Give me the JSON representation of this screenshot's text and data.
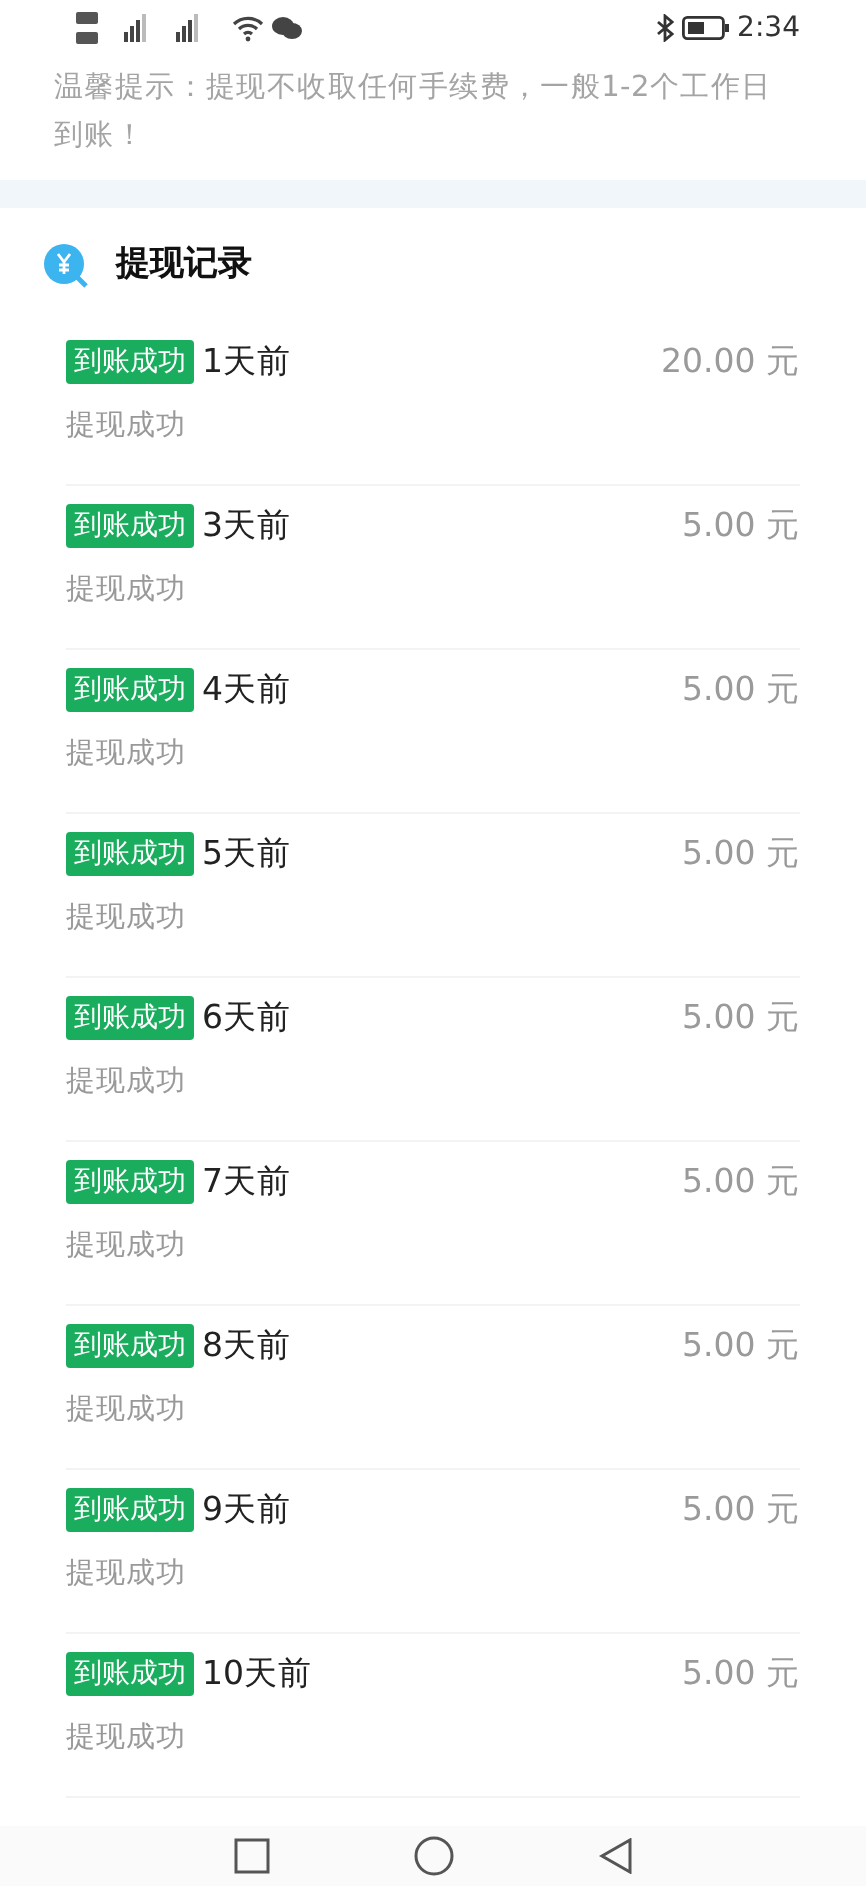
{
  "status_bar": {
    "time": "2:34"
  },
  "notice": "温馨提示：提现不收取任何手续费，一般1-2个工作日到账！",
  "section_title": "提现记录",
  "records": [
    {
      "status": "到账成功",
      "time": "1天前",
      "amount": "20.00 元",
      "note": "提现成功"
    },
    {
      "status": "到账成功",
      "time": "3天前",
      "amount": "5.00 元",
      "note": "提现成功"
    },
    {
      "status": "到账成功",
      "time": "4天前",
      "amount": "5.00 元",
      "note": "提现成功"
    },
    {
      "status": "到账成功",
      "time": "5天前",
      "amount": "5.00 元",
      "note": "提现成功"
    },
    {
      "status": "到账成功",
      "time": "6天前",
      "amount": "5.00 元",
      "note": "提现成功"
    },
    {
      "status": "到账成功",
      "time": "7天前",
      "amount": "5.00 元",
      "note": "提现成功"
    },
    {
      "status": "到账成功",
      "time": "8天前",
      "amount": "5.00 元",
      "note": "提现成功"
    },
    {
      "status": "到账成功",
      "time": "9天前",
      "amount": "5.00 元",
      "note": "提现成功"
    },
    {
      "status": "到账成功",
      "time": "10天前",
      "amount": "5.00 元",
      "note": "提现成功"
    }
  ]
}
